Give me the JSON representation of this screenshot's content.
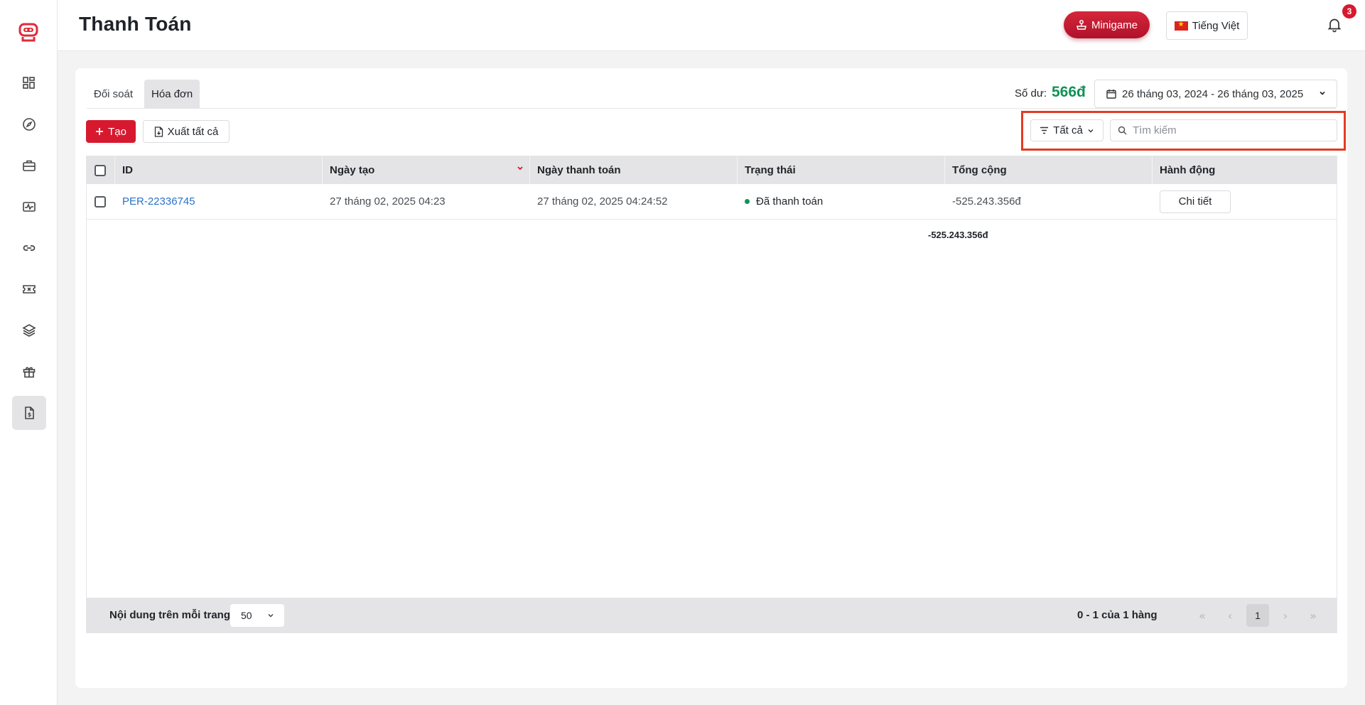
{
  "header": {
    "title": "Thanh Toán",
    "minigame_label": "Minigame",
    "language_label": "Tiếng Việt",
    "notification_count": "3"
  },
  "sidebar": {
    "items": [
      {
        "name": "dashboard",
        "icon": "grid-icon"
      },
      {
        "name": "explore",
        "icon": "compass-icon"
      },
      {
        "name": "briefcase",
        "icon": "briefcase-icon"
      },
      {
        "name": "activity",
        "icon": "activity-icon"
      },
      {
        "name": "links",
        "icon": "link-icon"
      },
      {
        "name": "tickets",
        "icon": "ticket-icon"
      },
      {
        "name": "layers",
        "icon": "layers-icon"
      },
      {
        "name": "gifts",
        "icon": "gift-icon"
      },
      {
        "name": "payments",
        "icon": "invoice-icon",
        "active": true
      }
    ]
  },
  "tabs": [
    {
      "label": "Đối soát",
      "active": false
    },
    {
      "label": "Hóa đơn",
      "active": true
    }
  ],
  "balance": {
    "label": "Số dư:",
    "value": "566đ"
  },
  "date_range": "26 tháng 03, 2024 - 26 tháng 03, 2025",
  "toolbar": {
    "create_label": "Tạo",
    "export_label": "Xuất tất cả",
    "filter_label": "Tất cả",
    "search_placeholder": "Tìm kiếm",
    "search_value": ""
  },
  "table": {
    "columns": [
      "ID",
      "Ngày tạo",
      "Ngày thanh toán",
      "Trạng thái",
      "Tổng cộng",
      "Hành động"
    ],
    "rows": [
      {
        "id": "PER-22336745",
        "created": "27 tháng 02, 2025 04:23",
        "paid": "27 tháng 02, 2025 04:24:52",
        "status": "Đã thanh toán",
        "total": "-525.243.356đ",
        "action": "Chi tiết"
      }
    ],
    "grand_total": "-525.243.356đ"
  },
  "footer": {
    "rows_per_page_label": "Nội dung trên mỗi trang:",
    "rows_per_page_value": "50",
    "range_text": "0 - 1 của 1 hàng",
    "current_page": "1"
  },
  "colors": {
    "brand_red": "#d7192f",
    "balance_green": "#109357",
    "link_blue": "#2a73c8",
    "highlight": "#e33b22"
  }
}
